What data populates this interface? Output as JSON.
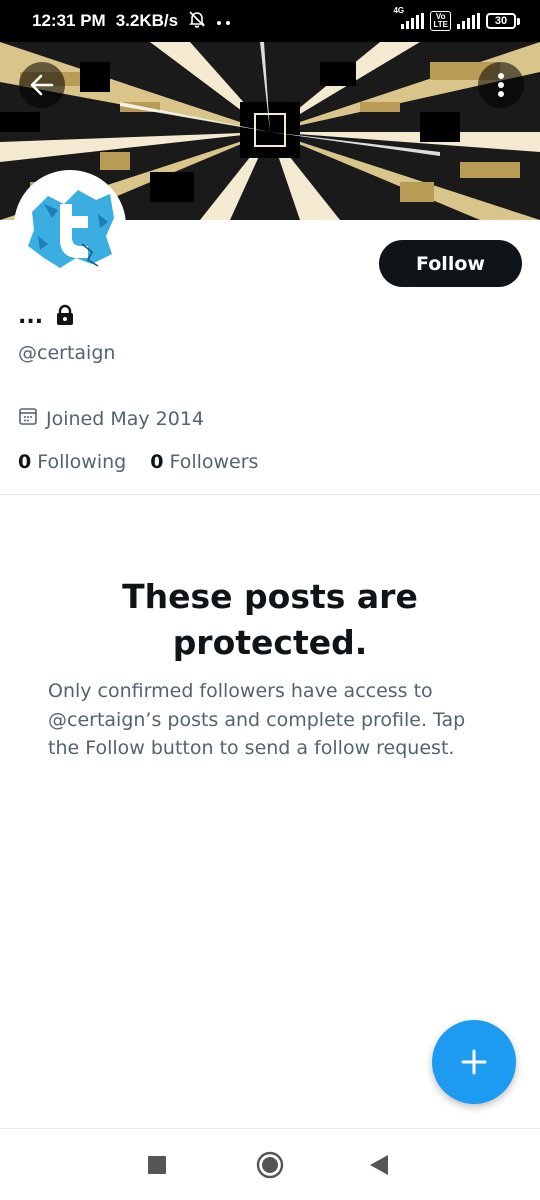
{
  "status_bar": {
    "time": "12:31 PM",
    "speed": "3.2KB/s",
    "network_tag": "4G",
    "volte_top": "Vo",
    "volte_bottom": "LTE",
    "battery": "30",
    "icons": [
      "bell-muted-icon",
      "dots-icon",
      "signal-icon",
      "volte-icon",
      "battery-icon"
    ]
  },
  "profile": {
    "display_name": "...",
    "handle": "@certaign",
    "joined": "Joined May 2014",
    "following_count": "0",
    "following_label": "Following",
    "followers_count": "0",
    "followers_label": "Followers",
    "follow_button": "Follow"
  },
  "protected": {
    "title": "These posts are protected.",
    "body": "Only confirmed followers have access to @certaign’s posts and complete profile. Tap the Follow button to send a follow request."
  },
  "colors": {
    "accent": "#1d9bf0",
    "primary_text": "#0f1419",
    "secondary_text": "#536471",
    "follow_button_bg": "#0f1419"
  }
}
